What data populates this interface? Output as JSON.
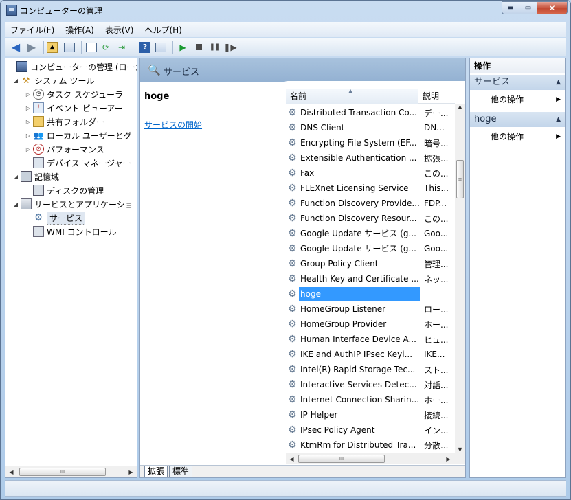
{
  "window": {
    "title": "コンピューターの管理",
    "minimize": "▬",
    "maximize": "▭",
    "close": "✕"
  },
  "menu": [
    {
      "label": "ファイル(F)"
    },
    {
      "label": "操作(A)"
    },
    {
      "label": "表示(V)"
    },
    {
      "label": "ヘルプ(H)"
    }
  ],
  "toolbar": {
    "back_icon": "◀",
    "forward_icon": "▶",
    "up_icon": "▲",
    "help_icon": "?",
    "play_icon": "▶",
    "pause_icon": "❚❚",
    "restart_icon": "❚▶"
  },
  "tree": {
    "items": [
      {
        "label": "コンピューターの管理 (ローカ",
        "toggle": "",
        "icon": "computer-icon",
        "glyph": ""
      },
      {
        "label": "システム ツール",
        "toggle": "◢",
        "icon": "tools-icon",
        "glyph": "⚒"
      },
      {
        "label": "タスク スケジューラ",
        "toggle": "▷",
        "icon": "clock-icon",
        "glyph": "◷"
      },
      {
        "label": "イベント ビューアー",
        "toggle": "▷",
        "icon": "event-viewer-icon",
        "glyph": "!"
      },
      {
        "label": "共有フォルダー",
        "toggle": "▷",
        "icon": "shared-folder-icon",
        "glyph": ""
      },
      {
        "label": "ローカル ユーザーとグ",
        "toggle": "▷",
        "icon": "users-icon",
        "glyph": "👥"
      },
      {
        "label": "パフォーマンス",
        "toggle": "▷",
        "icon": "performance-icon",
        "glyph": "⊘"
      },
      {
        "label": "デバイス マネージャー",
        "toggle": "",
        "icon": "device-manager-icon",
        "glyph": ""
      },
      {
        "label": "記憶域",
        "toggle": "◢",
        "icon": "storage-icon",
        "glyph": ""
      },
      {
        "label": "ディスクの管理",
        "toggle": "",
        "icon": "disk-icon",
        "glyph": ""
      },
      {
        "label": "サービスとアプリケーショ",
        "toggle": "◢",
        "icon": "services-apps-icon",
        "glyph": ""
      },
      {
        "label": "サービス",
        "toggle": "",
        "icon": "gear-icon",
        "glyph": "⚙"
      },
      {
        "label": "WMI コントロール",
        "toggle": "",
        "icon": "wmi-icon",
        "glyph": ""
      }
    ]
  },
  "middle": {
    "header_title": "サービス",
    "header_icon": "🔍",
    "selected_name": "hoge",
    "start_link": "サービスの開始",
    "columns": {
      "name": "名前",
      "desc": "説明"
    },
    "rows": [
      {
        "name": "Distributed Transaction Co...",
        "desc": "デー..."
      },
      {
        "name": "DNS Client",
        "desc": "DN..."
      },
      {
        "name": "Encrypting File System (EF...",
        "desc": "暗号..."
      },
      {
        "name": "Extensible Authentication ...",
        "desc": "拡張..."
      },
      {
        "name": "Fax",
        "desc": "この..."
      },
      {
        "name": "FLEXnet Licensing Service",
        "desc": "This..."
      },
      {
        "name": "Function Discovery Provide...",
        "desc": "FDP..."
      },
      {
        "name": "Function Discovery Resour...",
        "desc": "この..."
      },
      {
        "name": "Google Update サービス (g...",
        "desc": "Goo..."
      },
      {
        "name": "Google Update サービス (g...",
        "desc": "Goo..."
      },
      {
        "name": "Group Policy Client",
        "desc": "管理..."
      },
      {
        "name": "Health Key and Certificate ...",
        "desc": "ネッ..."
      },
      {
        "name": "hoge",
        "desc": ""
      },
      {
        "name": "HomeGroup Listener",
        "desc": "ロー..."
      },
      {
        "name": "HomeGroup Provider",
        "desc": "ホー..."
      },
      {
        "name": "Human Interface Device A...",
        "desc": "ヒュ..."
      },
      {
        "name": "IKE and AuthIP IPsec Keyi...",
        "desc": "IKE..."
      },
      {
        "name": "Intel(R) Rapid Storage Tec...",
        "desc": "スト..."
      },
      {
        "name": "Interactive Services Detec...",
        "desc": "対話..."
      },
      {
        "name": "Internet Connection Sharin...",
        "desc": "ホー..."
      },
      {
        "name": "IP Helper",
        "desc": "接続..."
      },
      {
        "name": "IPsec Policy Agent",
        "desc": "イン..."
      },
      {
        "name": "KtmRm for Distributed Tra...",
        "desc": "分散..."
      }
    ],
    "selected_index": 12,
    "tabs": [
      {
        "label": "拡張"
      },
      {
        "label": "標準"
      }
    ]
  },
  "actions": {
    "title": "操作",
    "sections": [
      {
        "label": "サービス",
        "item": "他の操作"
      },
      {
        "label": "hoge",
        "item": "他の操作"
      }
    ]
  },
  "scroll": {
    "left": "◀",
    "right": "▶",
    "up": "▲",
    "down": "▼",
    "grip": "III",
    "vgrip": "≡"
  }
}
